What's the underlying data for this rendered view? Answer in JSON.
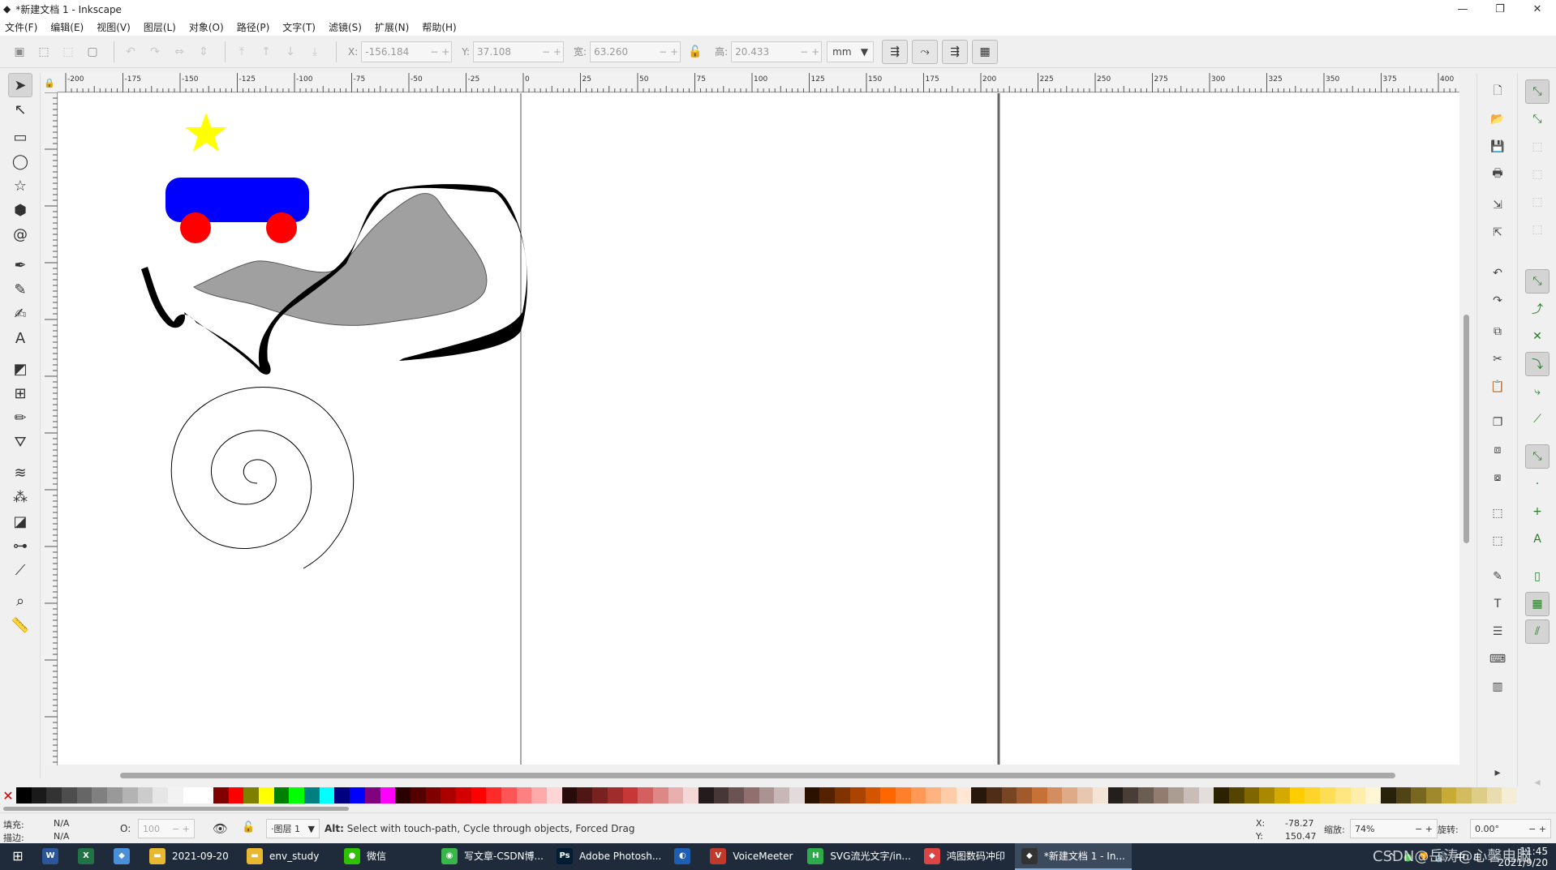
{
  "window": {
    "title": "*新建文档 1 - Inkscape",
    "min": "—",
    "max": "❐",
    "close": "✕"
  },
  "menu": [
    "文件(F)",
    "编辑(E)",
    "视图(V)",
    "图层(L)",
    "对象(O)",
    "路径(P)",
    "文字(T)",
    "滤镜(S)",
    "扩展(N)",
    "帮助(H)"
  ],
  "toolbar": {
    "x_label": "X:",
    "x_value": "-156.184",
    "y_label": "Y:",
    "y_value": "37.108",
    "w_label": "宽:",
    "w_value": "63.260",
    "h_label": "高:",
    "h_value": "20.433",
    "unit": "mm"
  },
  "ruler": {
    "labels": [
      "-200",
      "-175",
      "-150",
      "-125",
      "-100",
      "-75",
      "-50",
      "-25",
      "0",
      "25",
      "50",
      "75",
      "100",
      "125",
      "150",
      "175",
      "200",
      "225",
      "250",
      "275",
      "300",
      "325",
      "350",
      "375",
      "400"
    ]
  },
  "tools": [
    "selector-tool",
    "node-tool",
    "rectangle-tool",
    "ellipse-tool",
    "star-tool",
    "3dbox-tool",
    "spiral-tool",
    "pen-tool",
    "pencil-tool",
    "calligraphy-tool",
    "text-tool",
    "gradient-tool",
    "mesh-tool",
    "dropper-tool",
    "paintbucket-tool",
    "tweak-tool",
    "spray-tool",
    "eraser-tool",
    "connector-tool",
    "lpe-tool",
    "zoom-tool",
    "measure-tool"
  ],
  "colors": {
    "star": "#ffff00",
    "car_body": "#0000ff",
    "wheels": "#ff0000",
    "shape_fill": "#a0a0a0",
    "stroke": "#000000"
  },
  "palette": [
    "#000000",
    "#1a1a1a",
    "#333333",
    "#4d4d4d",
    "#666666",
    "#808080",
    "#999999",
    "#b3b3b3",
    "#cccccc",
    "#e6e6e6",
    "#f2f2f2",
    "#ffffff",
    "#ffffff",
    "#800000",
    "#ff0000",
    "#808000",
    "#ffff00",
    "#008000",
    "#00ff00",
    "#008080",
    "#00ffff",
    "#000080",
    "#0000ff",
    "#800080",
    "#ff00ff",
    "#2b0000",
    "#550000",
    "#800000",
    "#aa0000",
    "#d40000",
    "#ff0000",
    "#ff2a2a",
    "#ff5555",
    "#ff8080",
    "#ffaaaa",
    "#ffd5d5",
    "#280b0b",
    "#501616",
    "#782121",
    "#a02c2c",
    "#c83737",
    "#d35f5f",
    "#de8787",
    "#e9afaf",
    "#f4d7d7",
    "#241c1c",
    "#483737",
    "#6c5353",
    "#916f6f",
    "#ac9393",
    "#c8b7b7",
    "#e3dbdb",
    "#2b1100",
    "#552200",
    "#803300",
    "#aa4400",
    "#d45500",
    "#ff6600",
    "#ff7f2a",
    "#ff9955",
    "#ffb380",
    "#ffccaa",
    "#ffe6d5",
    "#28170b",
    "#502d16",
    "#784421",
    "#a05a2c",
    "#c87137",
    "#d38d5f",
    "#deaa87",
    "#e9c6af",
    "#f4e3d7",
    "#241f1c",
    "#483e37",
    "#6c5d53",
    "#917c6f",
    "#ac9d93",
    "#c8beb7",
    "#e3dedb",
    "#2b2200",
    "#554400",
    "#806600",
    "#aa8800",
    "#d4aa00",
    "#ffcc00",
    "#ffd42a",
    "#ffdd55",
    "#ffe680",
    "#ffeeaa",
    "#fff6d5",
    "#28220b",
    "#504416",
    "#786721",
    "#a0892c",
    "#c8ab37",
    "#d3bc5f",
    "#decd87",
    "#e9ddaf",
    "#f4eed7"
  ],
  "status": {
    "fill_label": "填充:",
    "fill_value": "N/A",
    "stroke_label": "描边:",
    "stroke_value": "N/A",
    "opacity_label": "O:",
    "opacity_value": "100",
    "layer": "·图层 1",
    "message_key": "Alt:",
    "message": " Select with touch-path, Cycle through objects, Forced Drag",
    "x_label": "X:",
    "x_value": "-78.27",
    "y_label": "Y:",
    "y_value": "150.47",
    "zoom_label": "缩放:",
    "zoom_value": "74%",
    "rotate_label": "旋转:",
    "rotate_value": "0.00°"
  },
  "taskbar": {
    "items": [
      {
        "label": "",
        "icon": "W",
        "color": "#2b579a"
      },
      {
        "label": "",
        "icon": "X",
        "color": "#217346"
      },
      {
        "label": "",
        "icon": "◆",
        "color": "#4a90d9"
      },
      {
        "label": "2021-09-20",
        "icon": "▬",
        "color": "#e8b830"
      },
      {
        "label": "env_study",
        "icon": "▬",
        "color": "#e8b830"
      },
      {
        "label": "微信",
        "icon": "●",
        "color": "#2dc100"
      },
      {
        "label": "写文章-CSDN博...",
        "icon": "◉",
        "color": "#3ab54a"
      },
      {
        "label": "Adobe Photosh...",
        "icon": "Ps",
        "color": "#001d34"
      },
      {
        "label": "",
        "icon": "◐",
        "color": "#1e5fb4"
      },
      {
        "label": "VoiceMeeter",
        "icon": "V",
        "color": "#c0392b"
      },
      {
        "label": "SVG流光文字/in...",
        "icon": "H",
        "color": "#2eaa4a"
      },
      {
        "label": "鸿图数码冲印",
        "icon": "◆",
        "color": "#d44"
      },
      {
        "label": "*新建文档 1 - In...",
        "icon": "◆",
        "color": "#333"
      }
    ],
    "time": "11:45",
    "date": "2021/9/20",
    "ime": "中",
    "watermark": "CSDN@岳涛@心馨电脑"
  }
}
